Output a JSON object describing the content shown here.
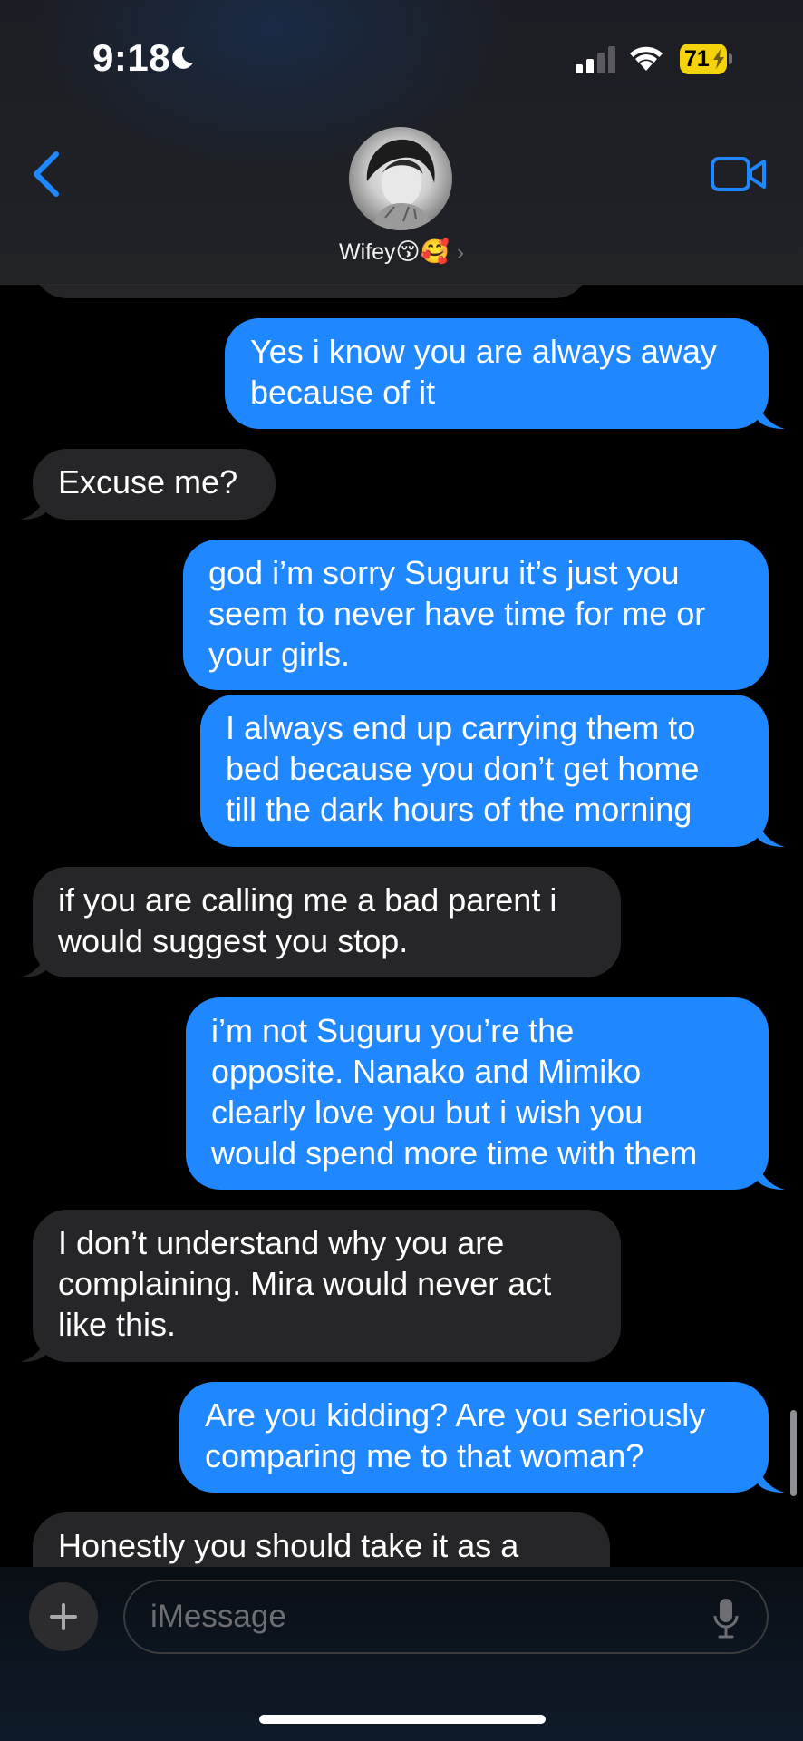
{
  "status_bar": {
    "time": "9:18",
    "battery_level": "71",
    "icons": [
      "moon-icon",
      "cellular-signal-icon",
      "wifi-icon",
      "battery-charging-icon"
    ]
  },
  "header": {
    "contact_name": "Wifey",
    "contact_emojis": "😚🥰",
    "chevron": "›",
    "icons": [
      "back-chevron-icon",
      "avatar",
      "video-camera-icon"
    ],
    "accent_color": "#1f87ff"
  },
  "messages": [
    {
      "id": "m0",
      "sender": "them",
      "text": ""
    },
    {
      "id": "m1",
      "sender": "me",
      "text": "Yes i know you are always away\nbecause of it"
    },
    {
      "id": "m2",
      "sender": "them",
      "text": "Excuse me?"
    },
    {
      "id": "m3",
      "sender": "me",
      "text": "god i’m sorry Suguru it’s just you\nseem to never have time for me or\nyour girls."
    },
    {
      "id": "m4",
      "sender": "me",
      "text": "I always end up carrying them to\nbed because you don’t get home\ntill the dark hours of the morning"
    },
    {
      "id": "m5",
      "sender": "them",
      "text": "if you are calling me a bad parent i\nwould suggest you stop."
    },
    {
      "id": "m6",
      "sender": "me",
      "text": "i’m not Suguru you’re the\nopposite. Nanako and Mimiko\nclearly love you but i wish you\nwould spend more time with them"
    },
    {
      "id": "m7",
      "sender": "them",
      "text": "I don’t understand why you are\ncomplaining. Mira would never act\nlike this."
    },
    {
      "id": "m8",
      "sender": "me",
      "text": "Are you kidding? Are you seriously\ncomparing me to that woman?"
    },
    {
      "id": "m9",
      "sender": "them",
      "text": "Honestly you should take it as a"
    }
  ],
  "composer": {
    "placeholder": "iMessage",
    "value": "",
    "icons": [
      "plus-icon",
      "microphone-icon"
    ]
  },
  "colors": {
    "outgoing_bubble": "#1f87ff",
    "incoming_bubble": "#262628",
    "background": "#000000"
  }
}
